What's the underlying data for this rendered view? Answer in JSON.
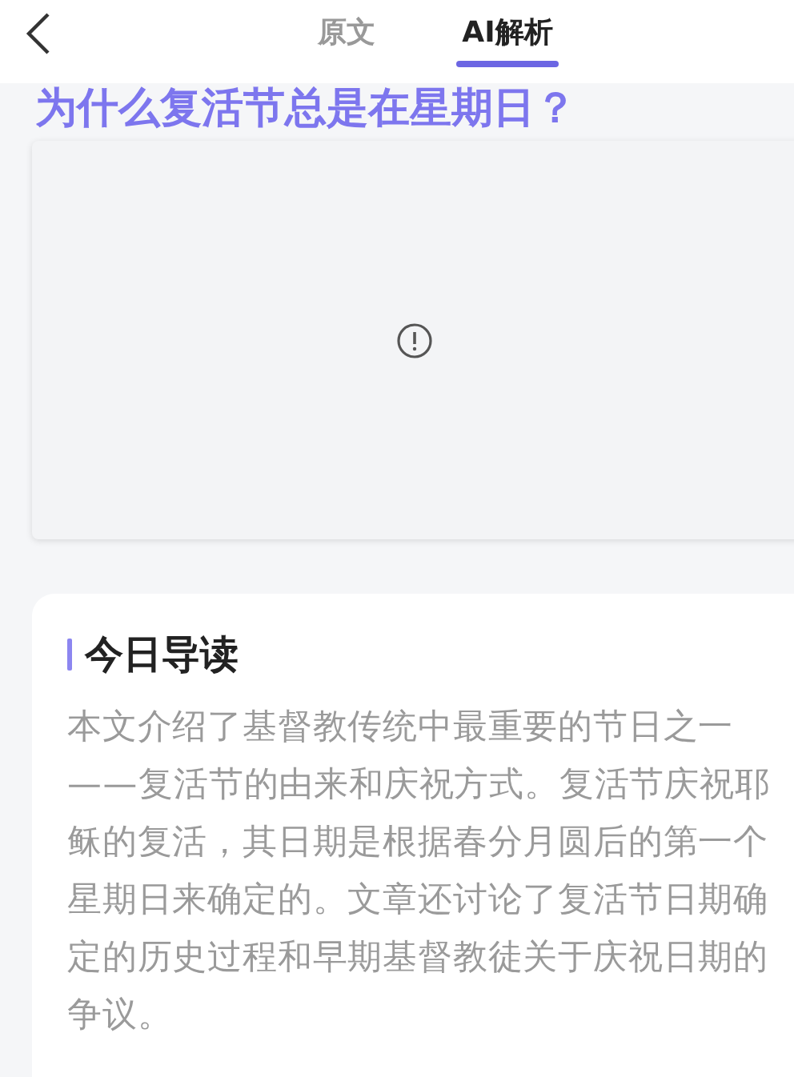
{
  "header": {
    "tabs": [
      {
        "label": "原文",
        "selected": false
      },
      {
        "label": "AI解析",
        "selected": true
      }
    ]
  },
  "article": {
    "title": "为什么复活节总是在星期日？",
    "image": {
      "kind": "broken"
    }
  },
  "guide": {
    "heading": "今日导读",
    "text": "本文介绍了基督教传统中最重要的节日之一——复活节的由来和庆祝方式。复活节庆祝耶稣的复活，其日期是根据春分月圆后的第一个星期日来确定的。文章还讨论了复活节日期确定的历史过程和早期基督教徒关于庆祝日期的争议。"
  }
}
